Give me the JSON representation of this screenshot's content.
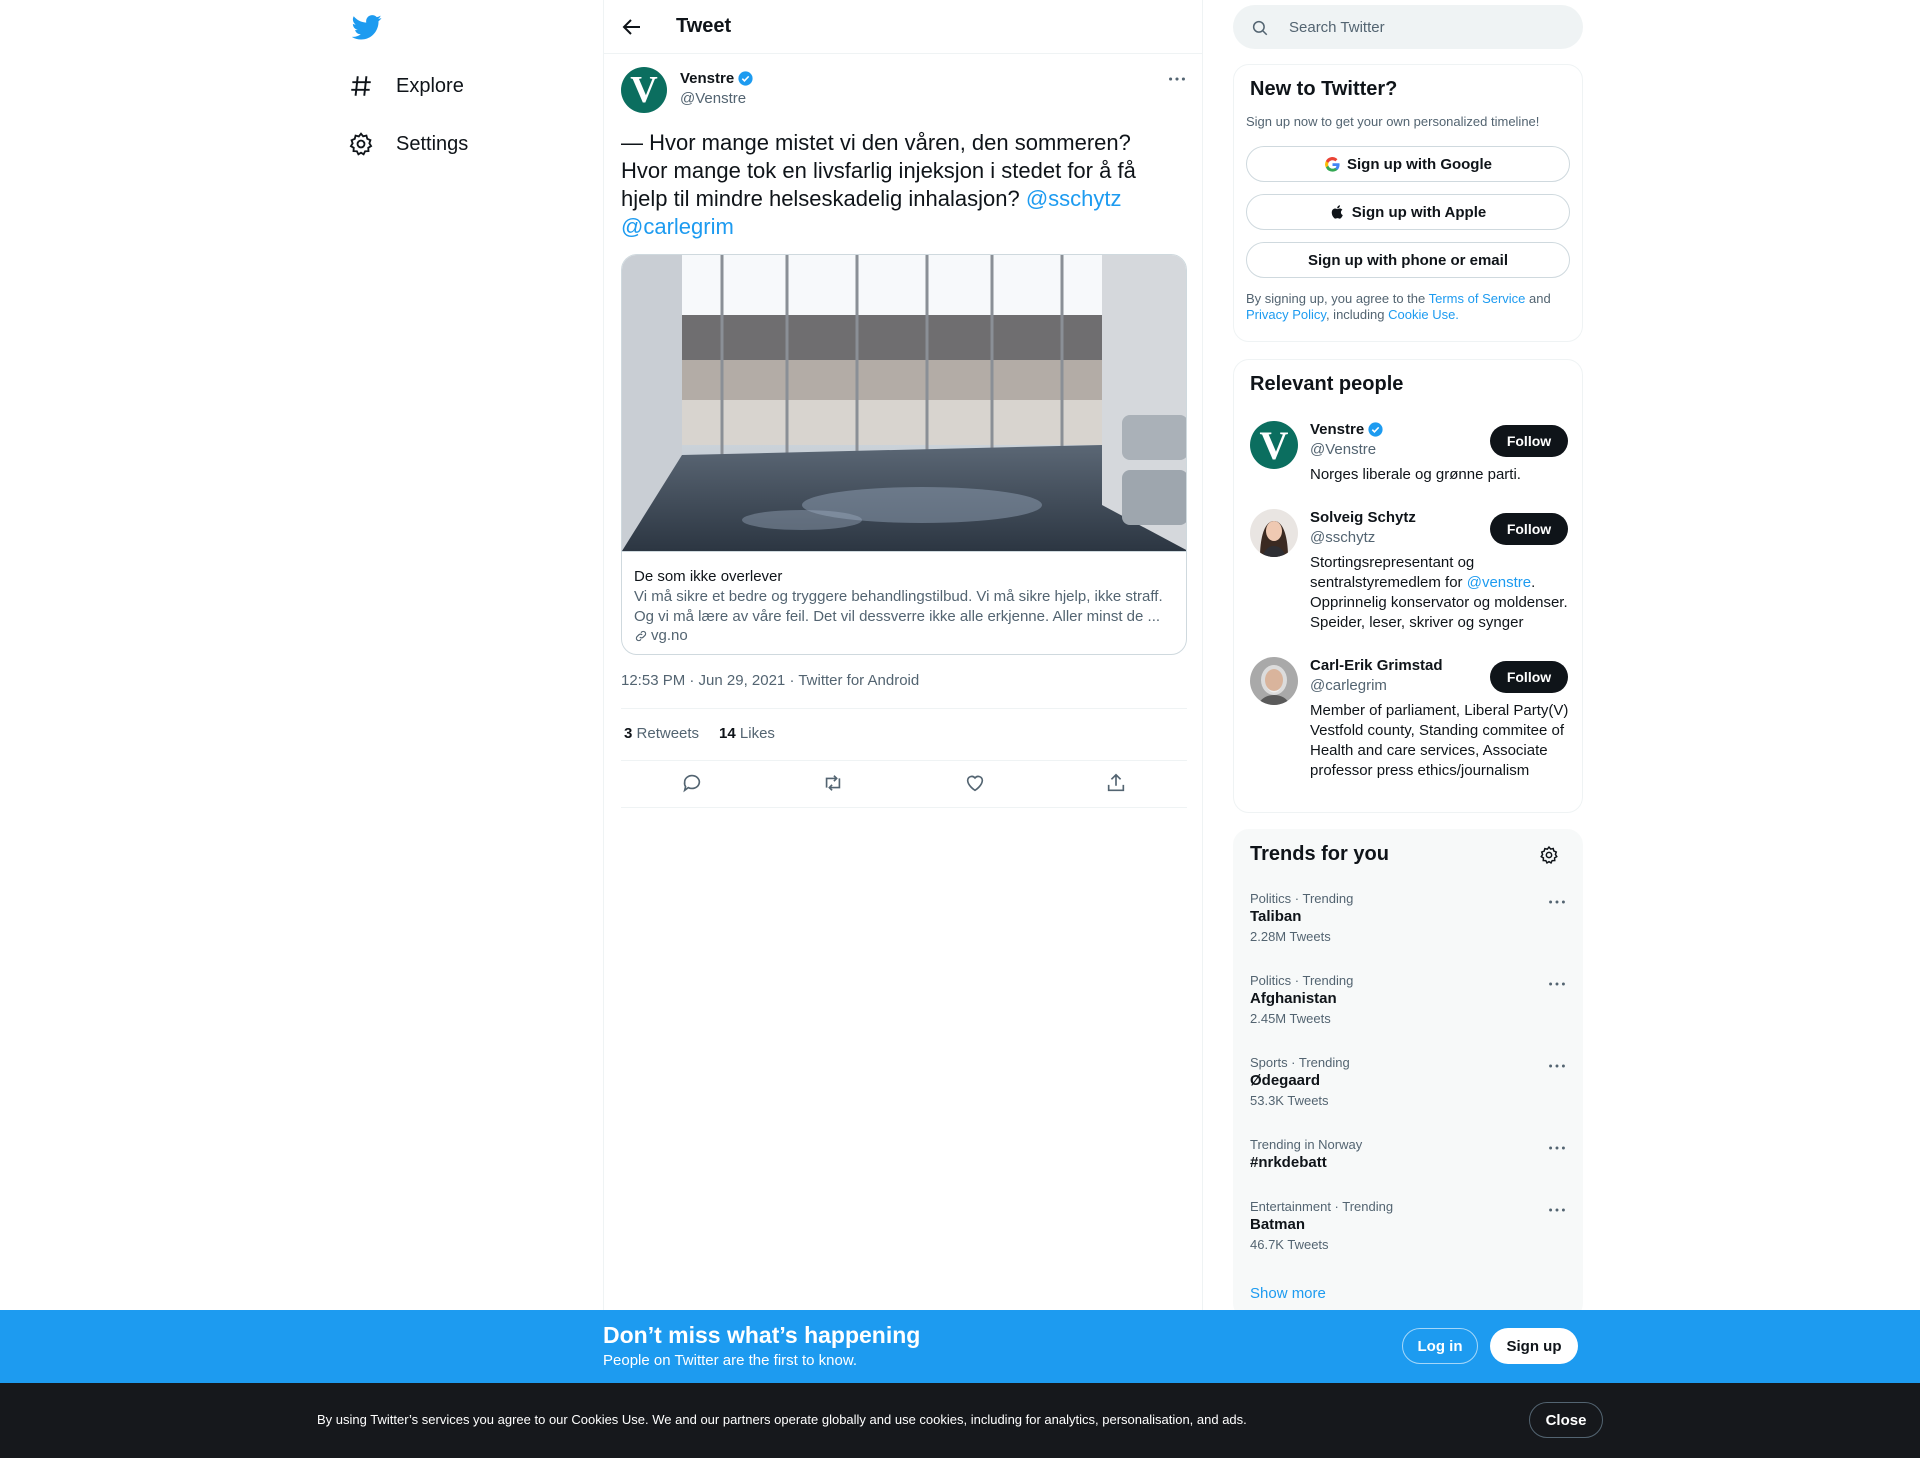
{
  "nav": {
    "items": [
      {
        "label": "Explore",
        "icon": "hashtag-icon"
      },
      {
        "label": "Settings",
        "icon": "gear-icon"
      }
    ]
  },
  "header": {
    "title": "Tweet"
  },
  "tweet": {
    "author_name": "Venstre",
    "author_handle": "@Venstre",
    "avatar_letter": "V",
    "text": "— Hvor mange mistet vi den våren, den sommeren? Hvor mange tok en livsfarlig injeksjon i stedet for å få hjelp til mindre helseskadelig inhalasjon? ",
    "mention1": "@sschytz",
    "mention2": "@carlegrim",
    "card": {
      "title": "De som ikke overlever",
      "description": "Vi må sikre et bedre og tryggere behandlingstilbud. Vi må sikre hjelp, ikke straff. Og vi må lære av våre feil. Det vil dessverre ikke alle erkjenne. Aller minst de ...",
      "domain": "vg.no"
    },
    "meta": "12:53 PM · Jun 29, 2021 · Twitter for Android",
    "retweets_count": "3",
    "retweets_label": "Retweets",
    "likes_count": "14",
    "likes_label": "Likes"
  },
  "search": {
    "placeholder": "Search Twitter"
  },
  "signup_box": {
    "title": "New to Twitter?",
    "subtitle": "Sign up now to get your own personalized timeline!",
    "google": "Sign up with Google",
    "apple": "Sign up with Apple",
    "phone": "Sign up with phone or email",
    "terms_prefix": "By signing up, you agree to the ",
    "terms_link": "Terms of Service",
    "terms_and": " and ",
    "privacy_link": "Privacy Policy",
    "including": ", including ",
    "cookie_link": "Cookie Use."
  },
  "relevant": {
    "title": "Relevant people",
    "follow_label": "Follow",
    "people": [
      {
        "name": "Venstre",
        "handle": "@Venstre",
        "bio": "Norges liberale og grønne parti."
      },
      {
        "name": "Solveig Schytz",
        "handle": "@sschytz",
        "bio_pre": "Stortingsrepresentant og sentralstyremedlem for ",
        "bio_link": "@venstre",
        "bio_post": ". Opprinnelig konservator og moldenser. Speider, leser, skriver og synger"
      },
      {
        "name": "Carl-Erik Grimstad",
        "handle": "@carlegrim",
        "bio": "Member of parliament, Liberal Party(V) Vestfold county, Standing commitee of Health and care services, Associate professor press ethics/journalism"
      }
    ]
  },
  "trends": {
    "title": "Trends for you",
    "items": [
      {
        "context": "Politics · Trending",
        "name": "Taliban",
        "count": "2.28M Tweets"
      },
      {
        "context": "Politics · Trending",
        "name": "Afghanistan",
        "count": "2.45M Tweets"
      },
      {
        "context": "Sports · Trending",
        "name": "Ødegaard",
        "count": "53.3K Tweets"
      },
      {
        "context": "Trending in Norway",
        "name": "#nrkdebatt",
        "count": ""
      },
      {
        "context": "Entertainment · Trending",
        "name": "Batman",
        "count": "46.7K Tweets"
      }
    ],
    "show_more": "Show more"
  },
  "banner": {
    "title": "Don’t miss what’s happening",
    "subtitle": "People on Twitter are the first to know.",
    "login": "Log in",
    "signup": "Sign up"
  },
  "cookie": {
    "text": "By using Twitter’s services you agree to our Cookies Use. We and our partners operate globally and use cookies, including for analytics, personalisation, and ads.",
    "close": "Close"
  },
  "colors": {
    "accent": "#1d9bf0",
    "dark": "#0f1419",
    "muted": "#536471",
    "cookie_bg": "#16181c"
  }
}
